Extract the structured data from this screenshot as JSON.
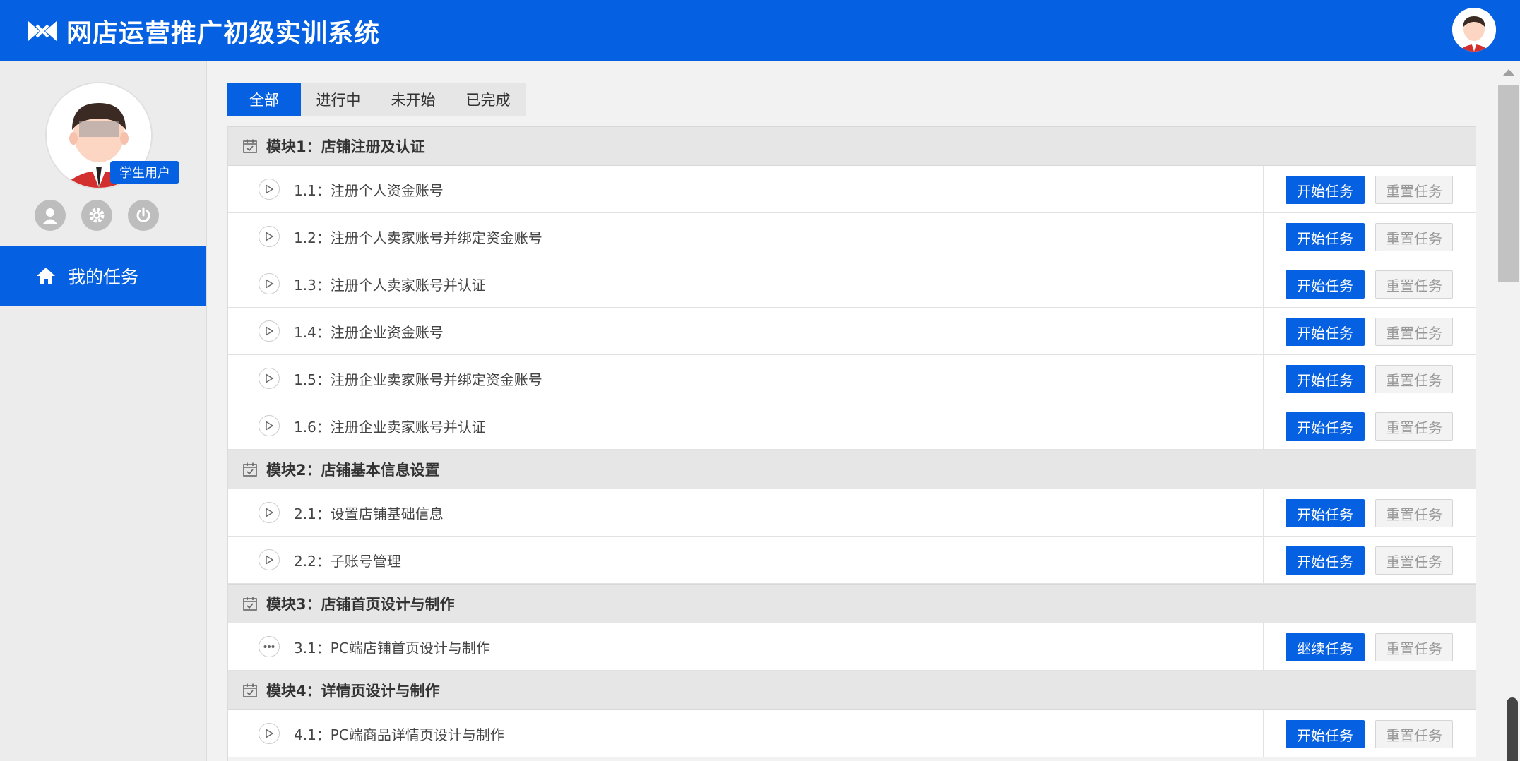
{
  "app": {
    "title": "网店运营推广初级实训系统"
  },
  "profile": {
    "role": "学生用户"
  },
  "nav": {
    "my_tasks": "我的任务"
  },
  "tabs": [
    {
      "label": "全部",
      "active": true
    },
    {
      "label": "进行中",
      "active": false
    },
    {
      "label": "未开始",
      "active": false
    },
    {
      "label": "已完成",
      "active": false
    }
  ],
  "modules": [
    {
      "title": "模块1：店铺注册及认证",
      "tasks": [
        {
          "name": "1.1：注册个人资金账号",
          "action": "开始任务",
          "reset": "重置任务",
          "status": "play-icon"
        },
        {
          "name": "1.2：注册个人卖家账号并绑定资金账号",
          "action": "开始任务",
          "reset": "重置任务",
          "status": "play-icon"
        },
        {
          "name": "1.3：注册个人卖家账号并认证",
          "action": "开始任务",
          "reset": "重置任务",
          "status": "play-icon"
        },
        {
          "name": "1.4：注册企业资金账号",
          "action": "开始任务",
          "reset": "重置任务",
          "status": "play-icon"
        },
        {
          "name": "1.5：注册企业卖家账号并绑定资金账号",
          "action": "开始任务",
          "reset": "重置任务",
          "status": "play-icon"
        },
        {
          "name": "1.6：注册企业卖家账号并认证",
          "action": "开始任务",
          "reset": "重置任务",
          "status": "play-icon"
        }
      ]
    },
    {
      "title": "模块2：店铺基本信息设置",
      "tasks": [
        {
          "name": "2.1：设置店铺基础信息",
          "action": "开始任务",
          "reset": "重置任务",
          "status": "play-icon"
        },
        {
          "name": "2.2：子账号管理",
          "action": "开始任务",
          "reset": "重置任务",
          "status": "play-icon"
        }
      ]
    },
    {
      "title": "模块3：店铺首页设计与制作",
      "tasks": [
        {
          "name": "3.1：PC端店铺首页设计与制作",
          "action": "继续任务",
          "reset": "重置任务",
          "status": "ellipsis-icon"
        }
      ]
    },
    {
      "title": "模块4：详情页设计与制作",
      "tasks": [
        {
          "name": "4.1：PC端商品详情页设计与制作",
          "action": "开始任务",
          "reset": "重置任务",
          "status": "play-icon"
        }
      ]
    }
  ],
  "colors": {
    "primary": "#0561e1",
    "sidebar_bg": "#ececec",
    "module_bg": "#e6e6e6"
  }
}
